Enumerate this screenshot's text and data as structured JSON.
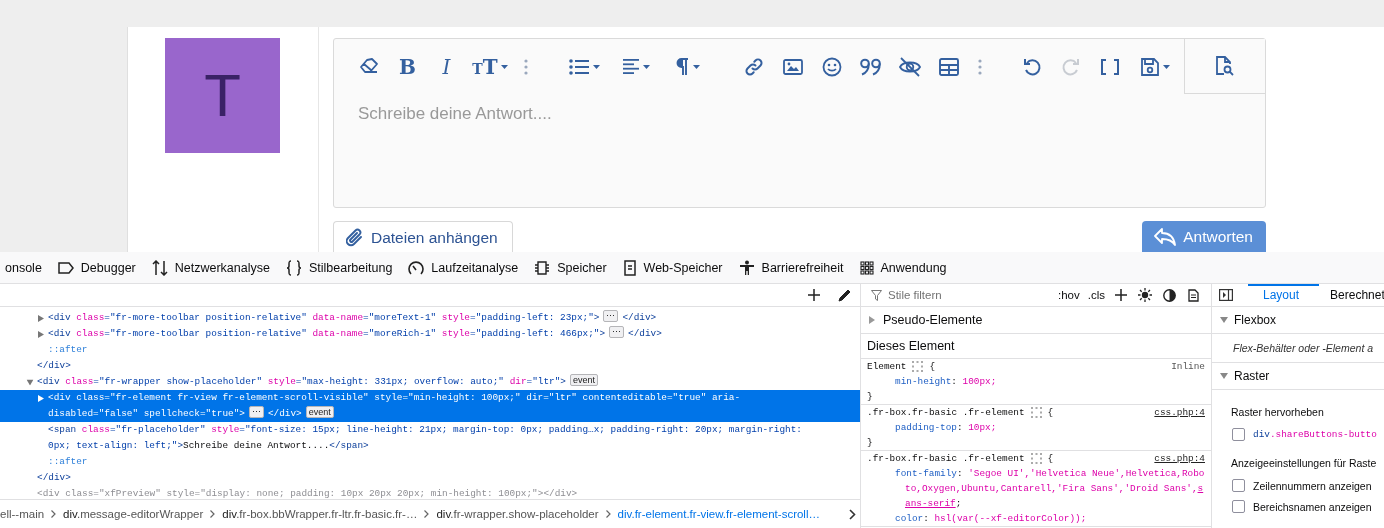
{
  "post": {
    "avatar_letter": "T",
    "editor": {
      "toolbar": {
        "bold": "B",
        "italic": "I",
        "text_size": "TT",
        "redo_disabled": true
      },
      "placeholder": "Schreibe deine Antwort...."
    },
    "attach_button": "Dateien anhängen",
    "reply_button": "Antworten"
  },
  "devtools": {
    "tabs": [
      {
        "label": "onsole",
        "selected": false
      },
      {
        "label": "Debugger",
        "selected": false
      },
      {
        "label": "Netzwerkanalyse",
        "selected": false
      },
      {
        "label": "Stilbearbeitung",
        "selected": false
      },
      {
        "label": "Laufzeitanalyse",
        "selected": false
      },
      {
        "label": "Speicher",
        "selected": false
      },
      {
        "label": "Web-Speicher",
        "selected": false
      },
      {
        "label": "Barrierefreiheit",
        "selected": false
      },
      {
        "label": "Anwendung",
        "selected": false
      }
    ],
    "markup": {
      "nodes": [
        {
          "children": [
            {
              "selected": false,
              "dimmed": false,
              "expanded": false,
              "line": [
                {
                  "kind": "code",
                  "tokens": [
                    {
                      "kind": "tag",
                      "text": "<div"
                    },
                    {
                      "kind": "attr",
                      "text": " class"
                    },
                    {
                      "kind": "value",
                      "text": "=\"fr-more-toolbar position-relative\""
                    },
                    {
                      "kind": "attr",
                      "text": " data-name"
                    },
                    {
                      "kind": "value",
                      "text": "=\"moreText-1\""
                    },
                    {
                      "kind": "attr",
                      "text": " style"
                    },
                    {
                      "kind": "value",
                      "text": "=\"padding-left: 23px;\""
                    },
                    {
                      "kind": "tag",
                      "text": ">"
                    }
                  ]
                },
                {
                  "kind": "badge",
                  "text": "⋯"
                },
                {
                  "kind": "code",
                  "tokens": [
                    {
                      "kind": "tag",
                      "text": "</div>"
                    }
                  ]
                }
              ]
            },
            {
              "selected": false,
              "dimmed": false,
              "expanded": false,
              "line": [
                {
                  "kind": "code",
                  "tokens": [
                    {
                      "kind": "tag",
                      "text": "<div"
                    },
                    {
                      "kind": "attr",
                      "text": " class"
                    },
                    {
                      "kind": "value",
                      "text": "=\"fr-more-toolbar position-relative\""
                    },
                    {
                      "kind": "attr",
                      "text": " data-name"
                    },
                    {
                      "kind": "value",
                      "text": "=\"moreRich-1\""
                    },
                    {
                      "kind": "attr",
                      "text": " style"
                    },
                    {
                      "kind": "value",
                      "text": "=\"padding-left: 466px;\""
                    },
                    {
                      "kind": "tag",
                      "text": ">"
                    }
                  ]
                },
                {
                  "kind": "badge",
                  "text": "⋯"
                },
                {
                  "kind": "code",
                  "tokens": [
                    {
                      "kind": "tag",
                      "text": "</div>"
                    }
                  ]
                }
              ]
            },
            {
              "selected": false,
              "dimmed": false,
              "line": [
                {
                  "kind": "code",
                  "tokens": [
                    {
                      "kind": "pseudo",
                      "text": "::after"
                    }
                  ]
                }
              ]
            }
          ]
        },
        {
          "selected": false,
          "dimmed": false,
          "line": [
            {
              "kind": "code",
              "tokens": [
                {
                  "kind": "tag",
                  "text": "</div>"
                }
              ]
            }
          ]
        },
        {
          "selected": false,
          "dimmed": false,
          "expanded": true,
          "line": [
            {
              "kind": "code",
              "tokens": [
                {
                  "kind": "tag",
                  "text": "<div"
                },
                {
                  "kind": "attr",
                  "text": " class"
                },
                {
                  "kind": "value",
                  "text": "=\"fr-wrapper show-placeholder\""
                },
                {
                  "kind": "attr",
                  "text": " style"
                },
                {
                  "kind": "value",
                  "text": "=\"max-height: 331px; overflow: auto;\""
                },
                {
                  "kind": "attr",
                  "text": " dir"
                },
                {
                  "kind": "value",
                  "text": "=\"ltr\""
                },
                {
                  "kind": "tag",
                  "text": ">"
                }
              ]
            },
            {
              "kind": "badge",
              "text": "event"
            }
          ],
          "children": [
            {
              "selected": true,
              "dimmed": false,
              "expanded": false,
              "line": [
                {
                  "kind": "code",
                  "tokens": [
                    {
                      "kind": "tag",
                      "text": "<div"
                    },
                    {
                      "kind": "attr",
                      "text": " class"
                    },
                    {
                      "kind": "value",
                      "text": "=\"fr-element fr-view fr-element-scroll-visible\""
                    },
                    {
                      "kind": "attr",
                      "text": " style"
                    },
                    {
                      "kind": "value",
                      "text": "=\"min-height: 100px;\""
                    },
                    {
                      "kind": "attr",
                      "text": " dir"
                    },
                    {
                      "kind": "value",
                      "text": "=\"ltr\""
                    },
                    {
                      "kind": "attr",
                      "text": " contenteditable"
                    },
                    {
                      "kind": "value",
                      "text": "=\"true\""
                    },
                    {
                      "kind": "attr",
                      "text": " aria-"
                    }
                  ]
                },
                {
                  "kind": "code",
                  "tokens": [
                    {
                      "kind": "attr",
                      "text": "disabled"
                    },
                    {
                      "kind": "value",
                      "text": "=\"false\""
                    },
                    {
                      "kind": "attr",
                      "text": " spellcheck"
                    },
                    {
                      "kind": "value",
                      "text": "=\"true\""
                    },
                    {
                      "kind": "tag",
                      "text": ">"
                    }
                  ]
                },
                {
                  "kind": "badge",
                  "text": "⋯"
                },
                {
                  "kind": "code",
                  "tokens": [
                    {
                      "kind": "tag",
                      "text": "</div>"
                    }
                  ]
                },
                {
                  "kind": "badge",
                  "text": "event"
                }
              ]
            },
            {
              "selected": false,
              "dimmed": false,
              "line": [
                {
                  "kind": "code",
                  "tokens": [
                    {
                      "kind": "tag",
                      "text": "<span"
                    },
                    {
                      "kind": "attr",
                      "text": " class"
                    },
                    {
                      "kind": "value",
                      "text": "=\"fr-placeholder\""
                    },
                    {
                      "kind": "attr",
                      "text": " style"
                    },
                    {
                      "kind": "value",
                      "text": "=\"font-size: 15px; line-height: 21px; margin-top: 0px; padding…x; padding-right: 20px; margin-right: "
                    }
                  ]
                },
                {
                  "kind": "code",
                  "tokens": [
                    {
                      "kind": "value",
                      "text": "0px; text-align: left;\""
                    },
                    {
                      "kind": "tag",
                      "text": ">"
                    },
                    {
                      "kind": "text",
                      "text": "Schreibe deine Antwort...."
                    },
                    {
                      "kind": "tag",
                      "text": "</span>"
                    }
                  ]
                }
              ]
            },
            {
              "selected": false,
              "dimmed": false,
              "line": [
                {
                  "kind": "code",
                  "tokens": [
                    {
                      "kind": "pseudo",
                      "text": "::after"
                    }
                  ]
                }
              ]
            }
          ]
        },
        {
          "selected": false,
          "dimmed": false,
          "line": [
            {
              "kind": "code",
              "tokens": [
                {
                  "kind": "tag",
                  "text": "</div>"
                }
              ]
            }
          ]
        },
        {
          "selected": false,
          "dimmed": true,
          "line": [
            {
              "kind": "code",
              "tokens": [
                {
                  "kind": "tag",
                  "text": "<div"
                },
                {
                  "kind": "attr",
                  "text": " class"
                },
                {
                  "kind": "value",
                  "text": "=\"xfPreview\""
                },
                {
                  "kind": "attr",
                  "text": " style"
                },
                {
                  "kind": "value",
                  "text": "=\"display: none; padding: 10px 20px 20px; min-height: 100px;\""
                },
                {
                  "kind": "tag",
                  "text": "></div>"
                }
              ]
            }
          ]
        }
      ]
    },
    "breadcrumbs": [
      {
        "rest": "ell--main",
        "selected": false
      },
      {
        "tag": "div",
        "rest": ".message-editorWrapper",
        "selected": false
      },
      {
        "tag": "div",
        "rest": ".fr-box.bbWrapper.fr-ltr.fr-basic.fr-…",
        "selected": false
      },
      {
        "tag": "div",
        "rest": ".fr-wrapper.show-placeholder",
        "selected": false
      },
      {
        "tag": "div",
        "rest": ".fr-element.fr-view.fr-element-scroll…",
        "selected": true
      }
    ],
    "rules": {
      "filter_placeholder": "Stile filtern",
      "hov": ":hov",
      "cls": ".cls",
      "pseudo_section": {
        "label": "Pseudo-Elemente",
        "expanded": false
      },
      "this_element": "Dieses Element",
      "list": [
        {
          "selector": "Element",
          "open": "{",
          "close": "}",
          "source": "Inline",
          "source_link": false,
          "declarations": [
            {
              "prop": "min-height",
              "colon": ":",
              "value": "100px;"
            }
          ]
        },
        {
          "selector": ".fr-box.fr-basic .fr-element",
          "open": "{",
          "close": "}",
          "source": "css.php:4",
          "source_link": true,
          "declarations": [
            {
              "prop": "padding-top",
              "colon": ":",
              "value": "10px;"
            }
          ]
        },
        {
          "selector": ".fr-box.fr-basic .fr-element",
          "open": "{",
          "source": "css.php:4",
          "source_link": true,
          "declarations": [
            {
              "prop": "font-family",
              "colon": ":",
              "value": "'Segoe UI','Helvetica Neue',Helvetica,Roboto,Oxygen,Ubuntu,Cantarell,'Fira Sans','Droid Sans',",
              "link": "sans-serif",
              "after": ";"
            },
            {
              "prop": "color",
              "colon": ":",
              "value": "hsl(var(--xf-editorColor));"
            }
          ]
        }
      ]
    },
    "sidebar": {
      "tabs": [
        {
          "label": "Layout",
          "selected": true
        },
        {
          "label": "Berechnet",
          "selected": false
        }
      ],
      "flexbox": {
        "label": "Flexbox",
        "expanded": true,
        "note": "Flex-Behälter oder -Element a"
      },
      "grid": {
        "label": "Raster",
        "expanded": true,
        "highlight_title": "Raster hervorheben",
        "settings_title": "Anzeigeeinstellungen für Raste",
        "highlight_items": [
          {
            "tag": "div",
            "label": ".shareButtons-butto",
            "checked": false
          }
        ],
        "settings": [
          {
            "label": "Zeilennummern anzeigen",
            "checked": false
          },
          {
            "label": "Bereichsnamen anzeigen",
            "checked": false
          }
        ]
      }
    }
  }
}
